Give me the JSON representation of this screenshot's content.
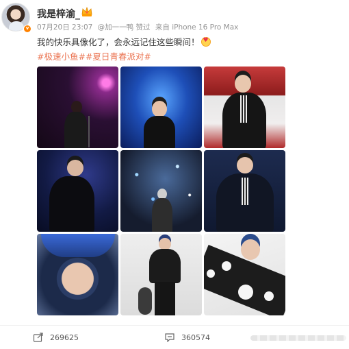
{
  "post": {
    "author": "我是梓渝_",
    "timestamp": "07月20日 23:07",
    "via": "@加一一鸭 赞过",
    "source": "来自 iPhone 16 Pro Max",
    "text": "我的快乐具像化了，会永远记住这些瞬间！",
    "hashtags": [
      "#极速小鱼#",
      "#夏日青春派对#"
    ],
    "photo_count": 9
  },
  "footer": {
    "reposts": "269625",
    "comments": "360574"
  },
  "icons": {
    "verified": "verified-badge-icon",
    "member": "crown-icon",
    "emoji": "heart-face-emoji-icon",
    "repost": "repost-icon",
    "comment": "comment-icon"
  },
  "colors": {
    "hashtag": "#eb7350",
    "meta": "#939393",
    "text": "#333333"
  }
}
